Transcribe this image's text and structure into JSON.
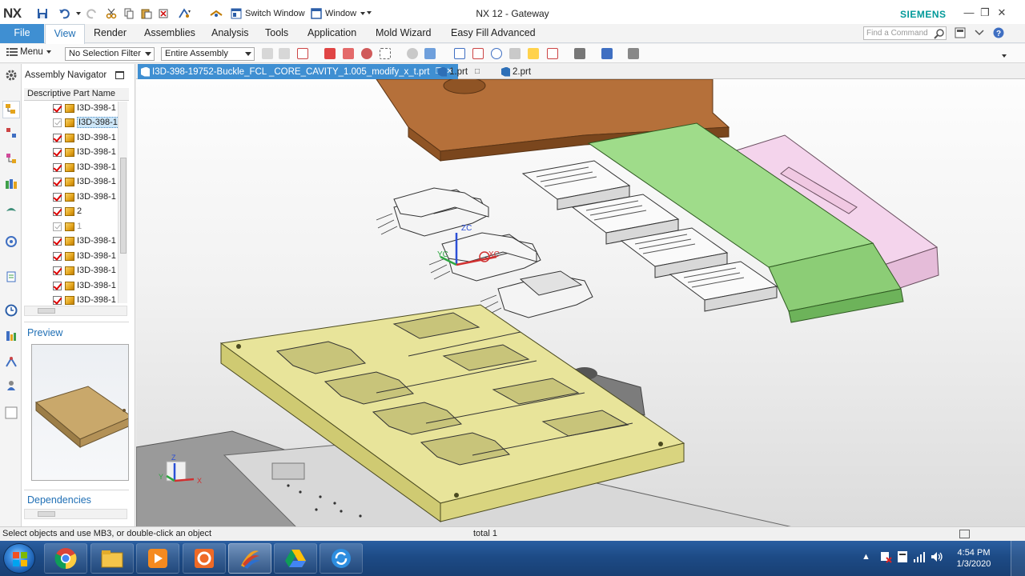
{
  "app": {
    "logo": "NX",
    "window_title": "NX 12 - Gateway",
    "brand": "SIEMENS",
    "switch_window_label": "Switch Window",
    "window_menu_label": "Window"
  },
  "ribbon": {
    "tabs": [
      {
        "label": "File"
      },
      {
        "label": "View"
      },
      {
        "label": "Render"
      },
      {
        "label": "Assemblies"
      },
      {
        "label": "Analysis"
      },
      {
        "label": "Tools"
      },
      {
        "label": "Application"
      },
      {
        "label": "Mold Wizard"
      },
      {
        "label": "Easy Fill Advanced"
      }
    ],
    "active_tab": "View",
    "find_command_placeholder": "Find a Command"
  },
  "toolbar": {
    "menu_label": "Menu",
    "selection_filter": "No Selection Filter",
    "scope": "Entire Assembly"
  },
  "navigator": {
    "title": "Assembly Navigator",
    "column_header": "Descriptive Part Name",
    "rows": [
      {
        "label": "I3D-398-1",
        "checked": true
      },
      {
        "label": "I3D-398-1",
        "checked": false,
        "selected": true
      },
      {
        "label": "I3D-398-1",
        "checked": true
      },
      {
        "label": "I3D-398-1",
        "checked": true
      },
      {
        "label": "I3D-398-1",
        "checked": true
      },
      {
        "label": "I3D-398-1",
        "checked": true
      },
      {
        "label": "I3D-398-1",
        "checked": true
      },
      {
        "label": "2",
        "checked": true
      },
      {
        "label": "1",
        "checked": false,
        "dim": true
      },
      {
        "label": "I3D-398-1",
        "checked": true
      },
      {
        "label": "I3D-398-1",
        "checked": true
      },
      {
        "label": "I3D-398-1",
        "checked": true
      },
      {
        "label": "I3D-398-1",
        "checked": true
      },
      {
        "label": "I3D-398-1",
        "checked": true
      }
    ],
    "preview_label": "Preview",
    "dependencies_label": "Dependencies"
  },
  "doc_tabs": [
    {
      "label": "I3D-398-19752-Buckle_FCL _CORE_CAVITY_1.005_modify_x_t.prt",
      "active": true
    },
    {
      "label": "1.prt",
      "active": false
    },
    {
      "label": "2.prt",
      "active": false
    }
  ],
  "viewport": {
    "axis_labels": {
      "x": "X",
      "y": "Y",
      "z": "Z",
      "xc": "XC",
      "yc": "YC",
      "zc": "ZC"
    }
  },
  "status": {
    "message": "Select objects and use MB3, or double-click an object",
    "total": "total 1"
  },
  "taskbar": {
    "time": "4:54 PM",
    "date": "1/3/2020",
    "apps": [
      "chrome-icon",
      "explorer-icon",
      "media-player-icon",
      "app-orange-icon",
      "nx-icon",
      "google-drive-icon",
      "sync-icon"
    ]
  },
  "colors": {
    "accent_blue": "#3f8fd2",
    "cavity_plate": "#e8e49a",
    "green_slider": "#9fdc8a",
    "pink_block": "#f4d4ec",
    "brown_plate": "#b5703a"
  }
}
